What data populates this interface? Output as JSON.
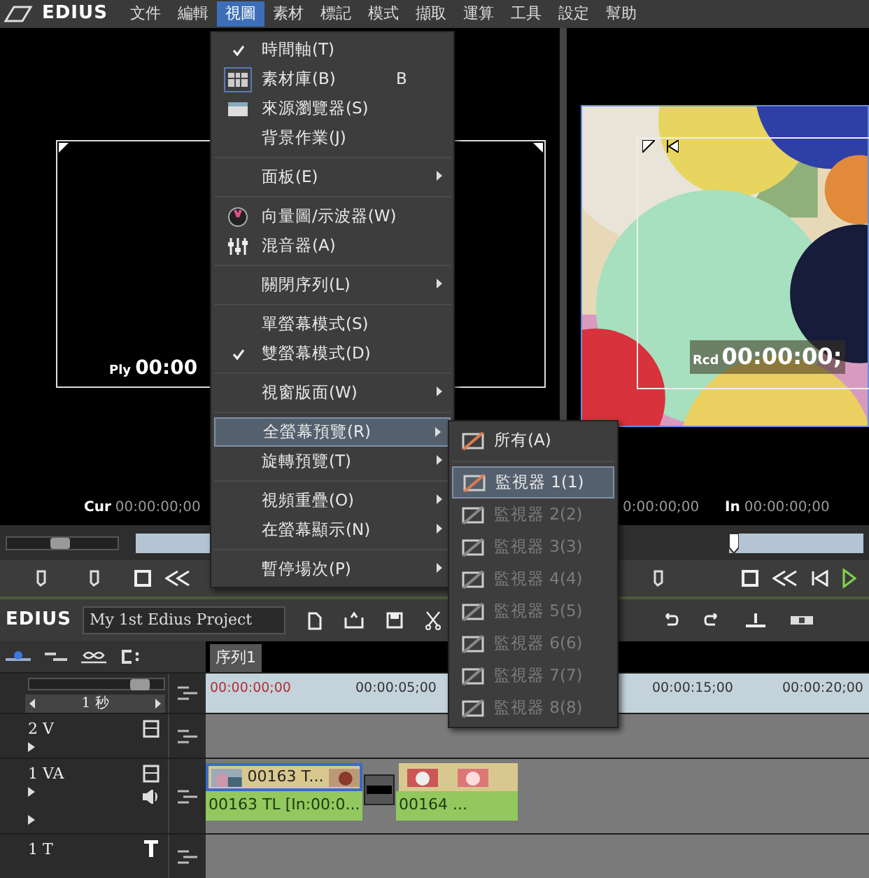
{
  "menubar": {
    "logo": "EDIUS",
    "menus": [
      {
        "label": "文件",
        "selected": false
      },
      {
        "label": "編輯",
        "selected": false
      },
      {
        "label": "視圖",
        "selected": true
      },
      {
        "label": "素材",
        "selected": false
      },
      {
        "label": "標記",
        "selected": false
      },
      {
        "label": "模式",
        "selected": false
      },
      {
        "label": "擷取",
        "selected": false
      },
      {
        "label": "運算",
        "selected": false
      },
      {
        "label": "工具",
        "selected": false
      },
      {
        "label": "設定",
        "selected": false
      },
      {
        "label": "幫助",
        "selected": false
      }
    ]
  },
  "player": {
    "timecode_label": "Ply",
    "timecode": "00:00",
    "cur_label": "Cur",
    "cur_value": "00:00:00;00",
    "shuttle": {
      "level": 0.45
    }
  },
  "recorder": {
    "timecode_label": "Rcd",
    "timecode": "00:00:00;",
    "cur_value": "0:00:00;00",
    "in_label": "In",
    "in_value": "00:00:00;00",
    "position": {
      "level": 0
    }
  },
  "project": {
    "app": "EDIUS",
    "name": "My 1st Edius Project"
  },
  "sequence_tabs": [
    {
      "label": "序列1",
      "selected": true
    }
  ],
  "timeline": {
    "zoom": {
      "level": 0.88
    },
    "scale": "1 秒",
    "ruler": [
      "00:00:00;00",
      "00:00:05;00",
      "00:00:15;00",
      "00:00:20;00"
    ],
    "tracks": [
      {
        "name": "2 V",
        "kind": "v"
      },
      {
        "name": "1 VA",
        "kind": "va",
        "clips": [
          {
            "video": "00163  T...",
            "audio": "00163  TL [In:00:0..."
          },
          {
            "audio": "00164  ..."
          }
        ]
      },
      {
        "name": "1 T",
        "kind": "t"
      }
    ]
  },
  "view_menu": {
    "items": [
      {
        "kind": "item",
        "label": "時間軸(T)",
        "checked": true,
        "submenu": false,
        "selected": false
      },
      {
        "kind": "item",
        "label": "素材庫(B)",
        "shortcut": "B",
        "checked": true,
        "submenu": false,
        "selected": false
      },
      {
        "kind": "item",
        "label": "來源瀏覽器(S)",
        "checked": false,
        "submenu": false,
        "selected": false
      },
      {
        "kind": "item",
        "label": "背景作業(J)",
        "checked": false,
        "submenu": false,
        "selected": false
      },
      {
        "kind": "separator"
      },
      {
        "kind": "item",
        "label": "面板(E)",
        "checked": false,
        "submenu": true,
        "selected": false
      },
      {
        "kind": "separator"
      },
      {
        "kind": "item",
        "label": "向量圖/示波器(W)",
        "checked": false,
        "submenu": false,
        "selected": false
      },
      {
        "kind": "item",
        "label": "混音器(A)",
        "checked": false,
        "submenu": false,
        "selected": false
      },
      {
        "kind": "separator"
      },
      {
        "kind": "item",
        "label": "關閉序列(L)",
        "checked": false,
        "submenu": true,
        "selected": false
      },
      {
        "kind": "separator"
      },
      {
        "kind": "item",
        "label": "單螢幕模式(S)",
        "checked": false,
        "submenu": false,
        "selected": false
      },
      {
        "kind": "item",
        "label": "雙螢幕模式(D)",
        "checked": true,
        "submenu": false,
        "selected": false
      },
      {
        "kind": "separator"
      },
      {
        "kind": "item",
        "label": "視窗版面(W)",
        "checked": false,
        "submenu": true,
        "selected": false
      },
      {
        "kind": "separator"
      },
      {
        "kind": "item",
        "label": "全螢幕預覽(R)",
        "checked": false,
        "submenu": true,
        "selected": true
      },
      {
        "kind": "item",
        "label": "旋轉預覽(T)",
        "checked": false,
        "submenu": true,
        "selected": false
      },
      {
        "kind": "separator"
      },
      {
        "kind": "item",
        "label": "視頻重疊(O)",
        "checked": false,
        "submenu": true,
        "selected": false
      },
      {
        "kind": "item",
        "label": "在螢幕顯示(N)",
        "checked": false,
        "submenu": true,
        "selected": false
      },
      {
        "kind": "separator"
      },
      {
        "kind": "item",
        "label": "暫停場次(P)",
        "checked": false,
        "submenu": true,
        "selected": false
      }
    ]
  },
  "fullscreen_submenu": {
    "items": [
      {
        "kind": "item",
        "label": "所有(A)",
        "selected": false,
        "disabled": false
      },
      {
        "kind": "separator"
      },
      {
        "kind": "item",
        "label": "監視器 1(1)",
        "selected": true,
        "disabled": false
      },
      {
        "kind": "item",
        "label": "監視器 2(2)",
        "selected": false,
        "disabled": true
      },
      {
        "kind": "item",
        "label": "監視器 3(3)",
        "selected": false,
        "disabled": true
      },
      {
        "kind": "item",
        "label": "監視器 4(4)",
        "selected": false,
        "disabled": true
      },
      {
        "kind": "item",
        "label": "監視器 5(5)",
        "selected": false,
        "disabled": true
      },
      {
        "kind": "item",
        "label": "監視器 6(6)",
        "selected": false,
        "disabled": true
      },
      {
        "kind": "item",
        "label": "監視器 7(7)",
        "selected": false,
        "disabled": true
      },
      {
        "kind": "item",
        "label": "監視器 8(8)",
        "selected": false,
        "disabled": true
      }
    ]
  }
}
